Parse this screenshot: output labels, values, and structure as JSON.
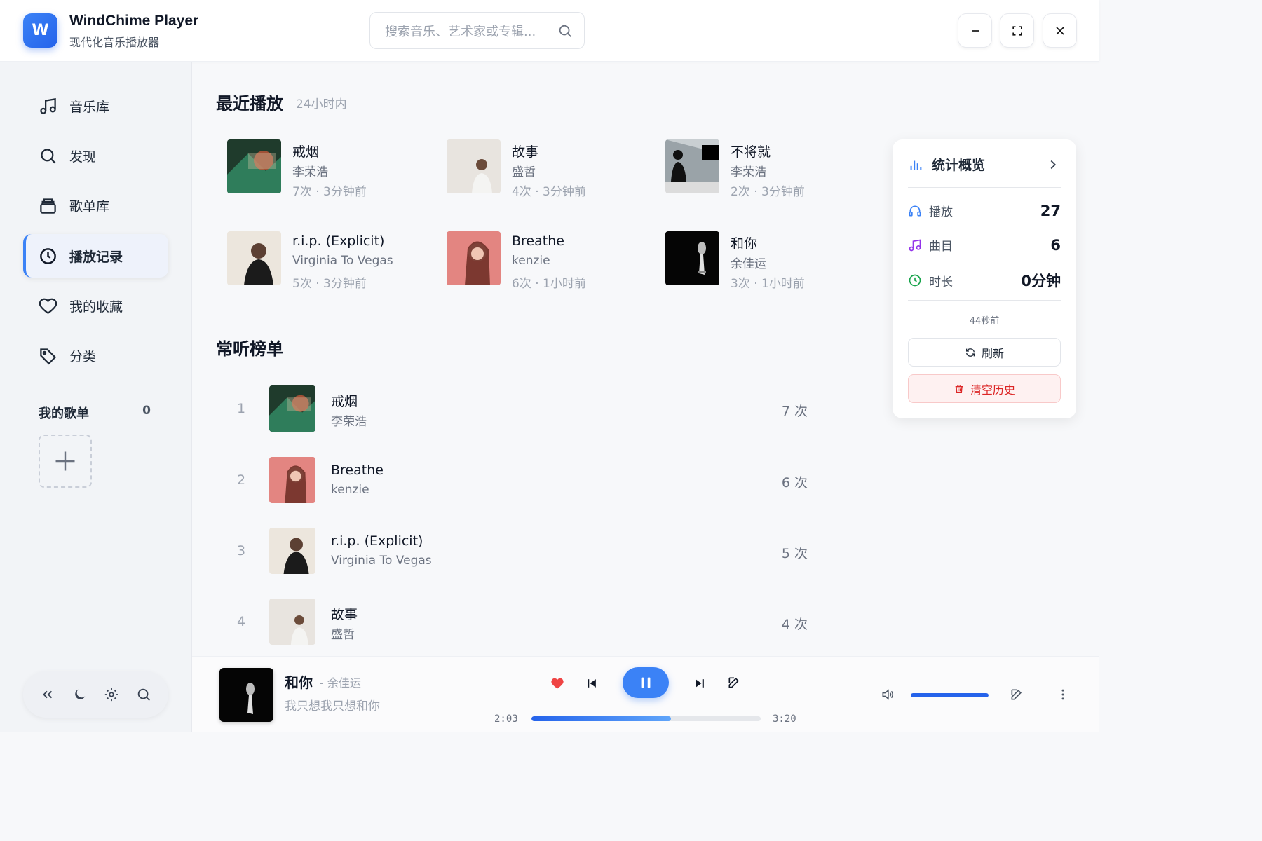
{
  "header": {
    "logo_letter": "W",
    "title": "WindChime Player",
    "subtitle": "现代化音乐播放器",
    "search_placeholder": "搜索音乐、艺术家或专辑..."
  },
  "sidebar": {
    "items": [
      {
        "label": "音乐库",
        "icon": "music-note-icon"
      },
      {
        "label": "发现",
        "icon": "search-icon"
      },
      {
        "label": "歌单库",
        "icon": "playlist-library-icon"
      },
      {
        "label": "播放记录",
        "icon": "clock-icon",
        "active": true
      },
      {
        "label": "我的收藏",
        "icon": "heart-icon"
      },
      {
        "label": "分类",
        "icon": "tag-icon"
      }
    ],
    "playlists_label": "我的歌单",
    "playlists_count": "0"
  },
  "recent": {
    "title": "最近播放",
    "subtitle": "24小时内",
    "items": [
      {
        "title": "戒烟",
        "artist": "李荣浩",
        "meta": "7次 · 3分钟前"
      },
      {
        "title": "故事",
        "artist": "盛哲",
        "meta": "4次 · 3分钟前"
      },
      {
        "title": "不将就",
        "artist": "李荣浩",
        "meta": "2次 · 3分钟前"
      },
      {
        "title": "r.i.p. (Explicit)",
        "artist": "Virginia To Vegas",
        "meta": "5次 · 3分钟前"
      },
      {
        "title": "Breathe",
        "artist": "kenzie",
        "meta": "6次 · 1小时前"
      },
      {
        "title": "和你",
        "artist": "余佳运",
        "meta": "3次 · 1小时前"
      }
    ]
  },
  "top": {
    "title": "常听榜单",
    "items": [
      {
        "rank": "1",
        "title": "戒烟",
        "artist": "李荣浩",
        "plays": "7 次"
      },
      {
        "rank": "2",
        "title": "Breathe",
        "artist": "kenzie",
        "plays": "6 次"
      },
      {
        "rank": "3",
        "title": "r.i.p. (Explicit)",
        "artist": "Virginia To Vegas",
        "plays": "5 次"
      },
      {
        "rank": "4",
        "title": "故事",
        "artist": "盛哲",
        "plays": "4 次"
      }
    ]
  },
  "stats": {
    "title": "统计概览",
    "plays_label": "播放",
    "plays_value": "27",
    "tracks_label": "曲目",
    "tracks_value": "6",
    "duration_label": "时长",
    "duration_value": "0分钟",
    "updated": "44秒前",
    "refresh_label": "刷新",
    "clear_label": "清空历史"
  },
  "player": {
    "title": "和你",
    "artist": "- 余佳运",
    "lyric": "我只想我只想和你",
    "current_time": "2:03",
    "total_time": "3:20",
    "progress": 0.61,
    "volume": 1.0,
    "liked": true
  },
  "colors": {
    "accent": "#3b82f6",
    "danger": "#dc2626",
    "like": "#ef4444"
  }
}
